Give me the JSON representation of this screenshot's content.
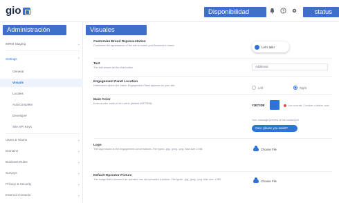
{
  "header": {
    "logo_text": "gio",
    "disponibilidad_label": "Disponibilidad",
    "status_label": "status",
    "icons": [
      "bell-icon",
      "help-icon",
      "gear-icon"
    ]
  },
  "sidebar": {
    "section_label": "Administración",
    "items": [
      {
        "label": "IMRM Staging",
        "level": 0,
        "chevron": true
      },
      {
        "label": "Settings",
        "level": 0,
        "chevron": true,
        "state": "group-open"
      },
      {
        "label": "General",
        "level": 1,
        "chevron": false
      },
      {
        "label": "Visuals",
        "level": 1,
        "chevron": false,
        "state": "active"
      },
      {
        "label": "Locales",
        "level": 1,
        "chevron": false
      },
      {
        "label": "AutoComplete",
        "level": 1,
        "chevron": false
      },
      {
        "label": "Developer",
        "level": 1,
        "chevron": false
      },
      {
        "label": "Site API Keys",
        "level": 1,
        "chevron": false
      },
      {
        "label": "Users & Teams",
        "level": 0,
        "chevron": true
      },
      {
        "label": "Domains",
        "level": 0,
        "chevron": true
      },
      {
        "label": "Business Rules",
        "level": 0,
        "chevron": true
      },
      {
        "label": "Surveys",
        "level": 0,
        "chevron": true
      },
      {
        "label": "Privacy & Security",
        "level": 0,
        "chevron": true
      },
      {
        "label": "External Contacts",
        "level": 0,
        "chevron": true
      }
    ]
  },
  "main": {
    "section_label": "Visuales",
    "sections": [
      {
        "title": "Customize Brand Representation",
        "desc": "Customize the appearance of the site to match your business's brand."
      },
      {
        "title": "Text",
        "desc": "The text shown as the chat button."
      },
      {
        "title": "Engagement Panel Location",
        "desc": "Determines where the Visitor Engagement Panel appears on your site."
      },
      {
        "title": "Main Color",
        "desc": "Enter a color code or hex value (default #2E73D8)."
      },
      {
        "title": "Logo",
        "desc": "The logo shown in the engagement conversations. File types: .jpg, .jpeg, .png. Max size 1 MB."
      },
      {
        "title": "Default Operator Picture",
        "desc": "The image that is shown if an operator has not uploaded a picture. File types: .jpg, .jpeg, .png. Max size 1 MB."
      }
    ],
    "chat_button_text": "Let's talk!",
    "text_select_value": "Additional",
    "location_options": [
      {
        "label": "Left",
        "selected": false
      },
      {
        "label": "Right",
        "selected": true
      }
    ],
    "main_color": {
      "hex": "#2E73D8",
      "swatch": "#2E73D8",
      "warning": "Low contrast. Consider a darker color."
    },
    "preview_label": "Your message preview of the contact pill",
    "preview_text": "Can I please you assist?",
    "file_button_label": "Choose File",
    "accent_color": "#2e73d8"
  }
}
